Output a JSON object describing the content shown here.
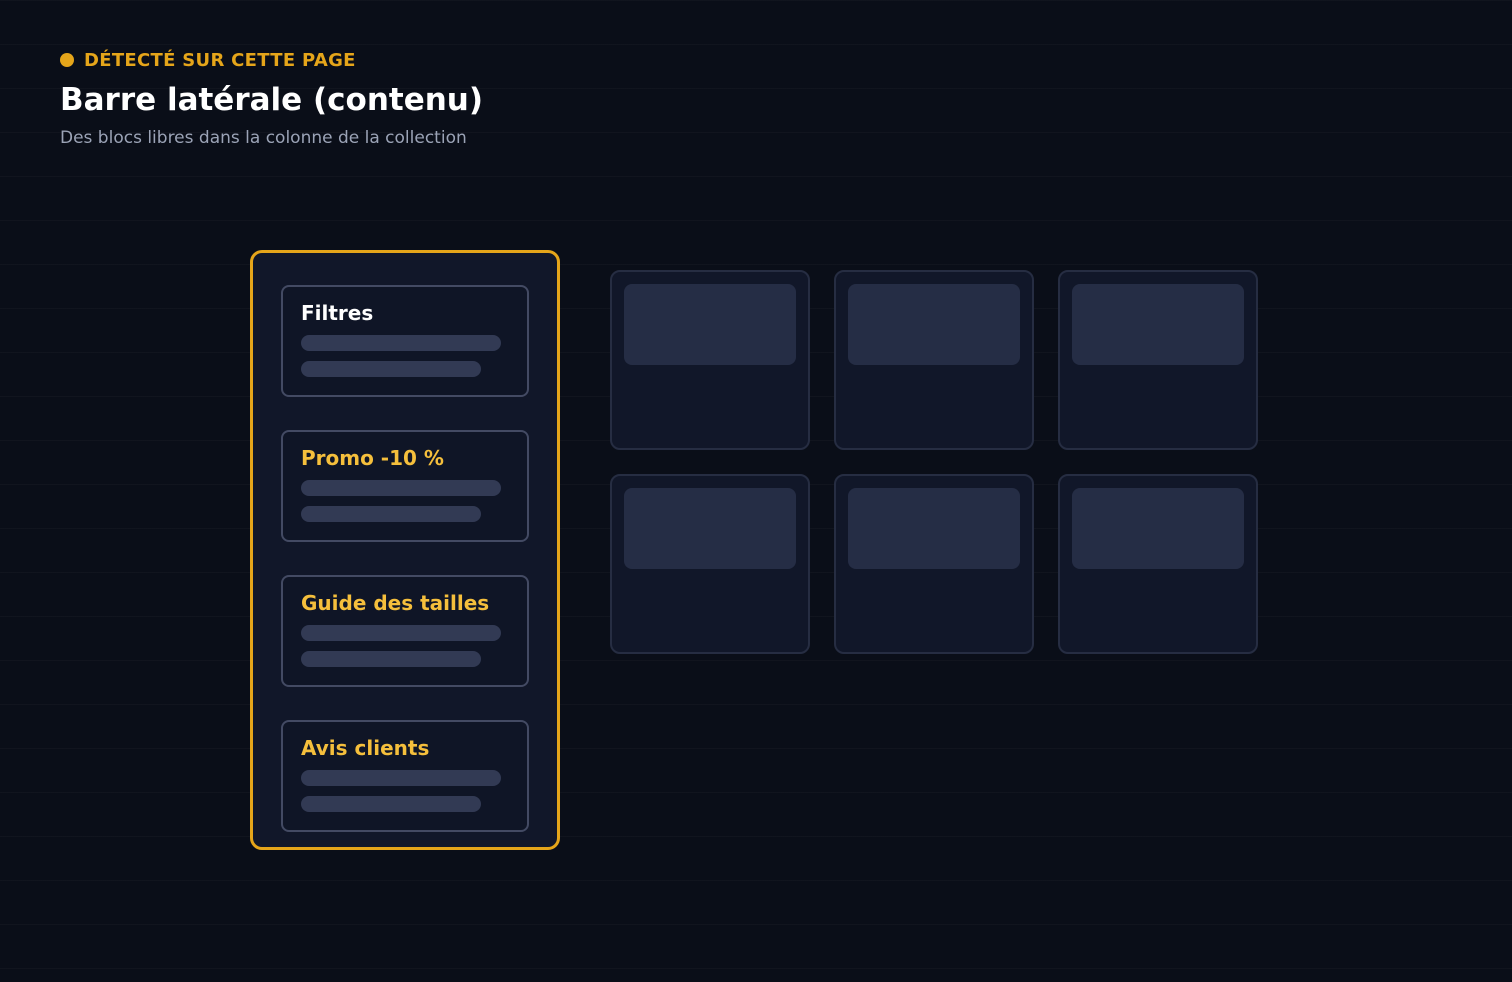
{
  "header": {
    "detected_label": "DÉTECTÉ SUR CETTE PAGE",
    "title": "Barre latérale (contenu)",
    "subtitle": "Des blocs libres dans la colonne de la collection"
  },
  "sidebar": {
    "blocks": [
      {
        "title": "Filtres",
        "title_color": "#ffffff"
      },
      {
        "title": "Promo -10 %",
        "title_color": "#f5bf3c"
      },
      {
        "title": "Guide des tailles",
        "title_color": "#f5bf3c"
      },
      {
        "title": "Avis clients",
        "title_color": "#f5bf3c"
      }
    ]
  },
  "product_grid": {
    "rows": 2,
    "columns": 3
  },
  "colors": {
    "accent": "#e5a51a",
    "highlight_text": "#f5bf3c",
    "background": "#0a0e18",
    "placeholder": "#323a54"
  }
}
